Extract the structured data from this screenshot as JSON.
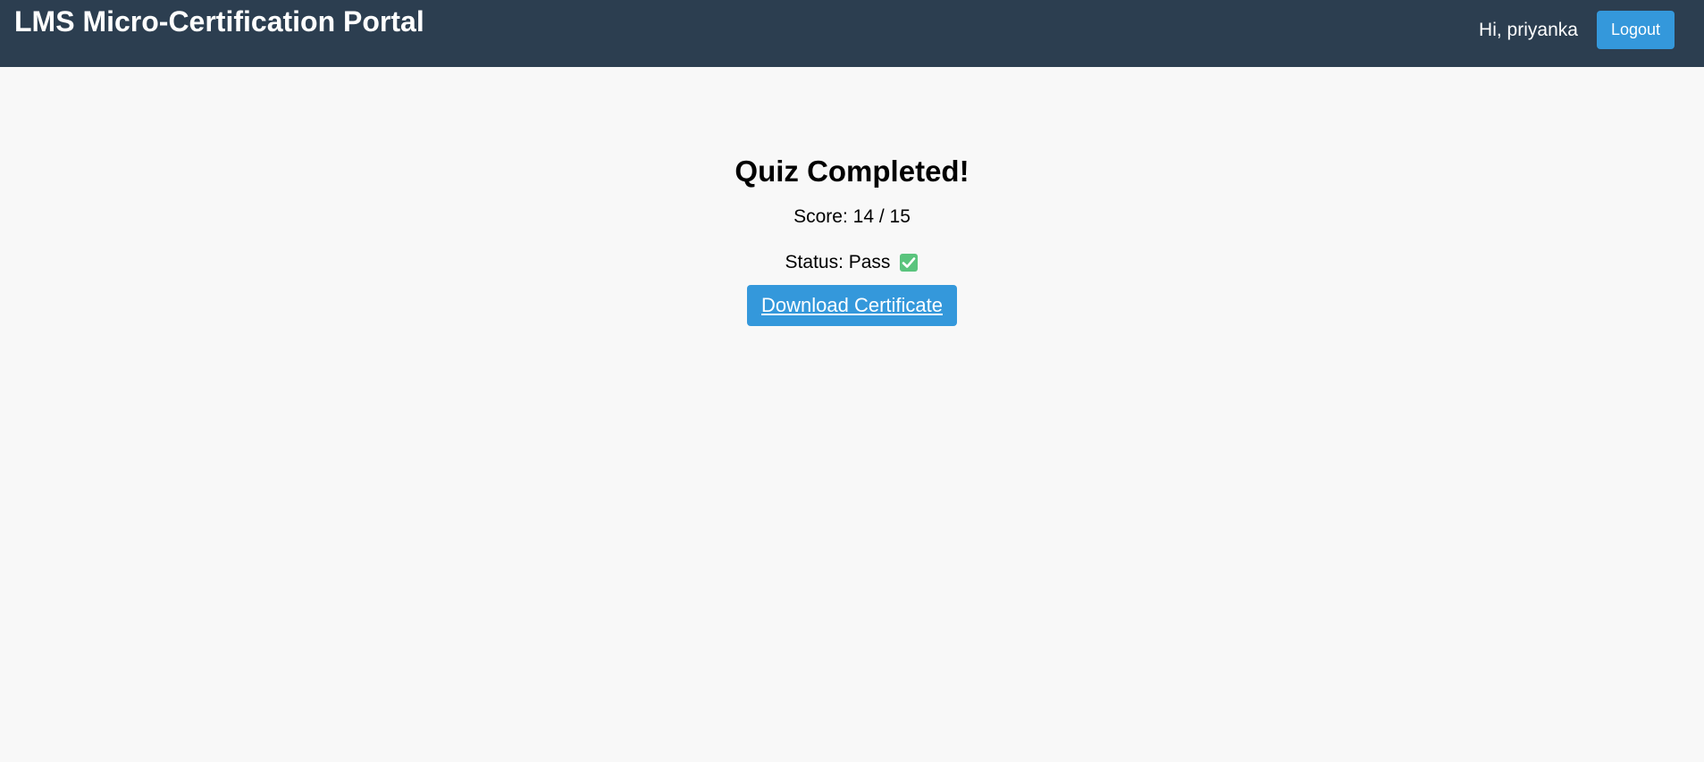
{
  "header": {
    "title": "LMS Micro-Certification Portal",
    "greeting": "Hi, priyanka",
    "logout_label": "Logout"
  },
  "result": {
    "heading": "Quiz Completed!",
    "score_text": "Score: 14 / 15",
    "status_text": "Status: Pass",
    "status_icon": "check-mark-icon",
    "download_label": "Download Certificate"
  },
  "colors": {
    "header_bg": "#2c3e50",
    "accent": "#3498db",
    "page_bg": "#f8f8f8",
    "pass_green": "#5ac47d"
  }
}
